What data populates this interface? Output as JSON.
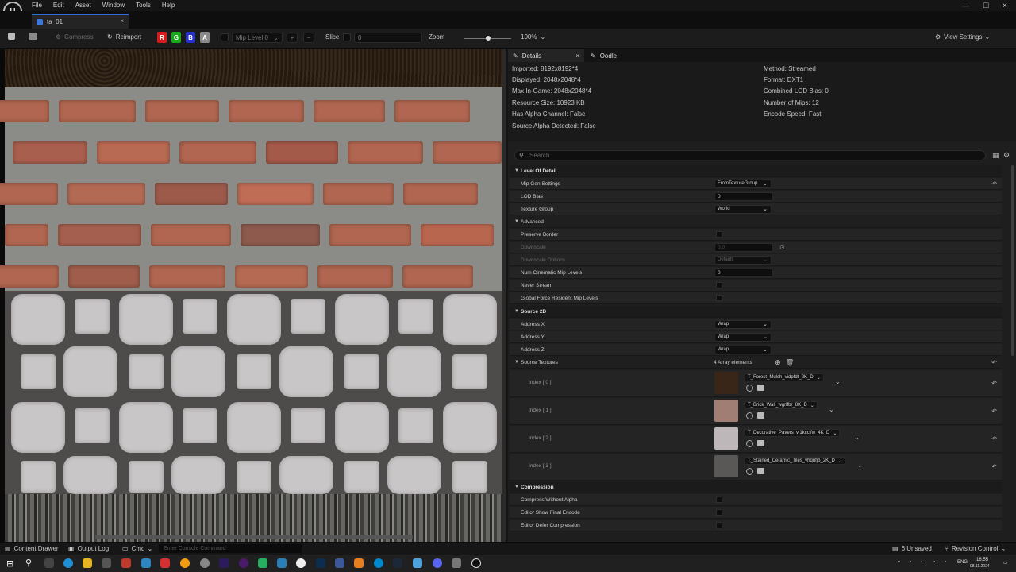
{
  "window": {
    "menus": [
      "File",
      "Edit",
      "Asset",
      "Window",
      "Tools",
      "Help"
    ],
    "logo_text": "U",
    "tab_title": "ta_01",
    "tab_close": "×",
    "controls": [
      "—",
      "☐",
      "✕"
    ]
  },
  "toolbar": {
    "compress": "Compress",
    "reimport": "Reimport",
    "channels": [
      "R",
      "G",
      "B",
      "A"
    ],
    "mip_level": "Mip Level 0",
    "slice_label": "Slice",
    "slice_value": "0",
    "zoom_label": "Zoom",
    "zoom_value": "100%",
    "view_settings": "View Settings"
  },
  "details": {
    "tab_details": "Details",
    "tab_oodle": "Oodle",
    "info_left": [
      "Imported: 8192x8192*4",
      "Displayed: 2048x2048*4",
      "Max In-Game: 2048x2048*4",
      "Resource Size: 10923 KB",
      "Has Alpha Channel: False",
      "Source Alpha Detected: False"
    ],
    "info_right": [
      "Method: Streamed",
      "Format: DXT1",
      "Combined LOD Bias: 0",
      "Number of Mips: 12",
      "Encode Speed: Fast"
    ],
    "search_placeholder": "Search",
    "lod": {
      "category": "Level Of Detail",
      "mip_gen_label": "Mip Gen Settings",
      "mip_gen_value": "FromTextureGroup",
      "lod_bias_label": "LOD Bias",
      "lod_bias_value": "0",
      "texture_group_label": "Texture Group",
      "texture_group_value": "World",
      "advanced": "Advanced",
      "preserve_border": "Preserve Border",
      "downscale": "Downscale",
      "downscale_value": "0.0",
      "downscale_options": "Downscale Options",
      "downscale_options_value": "Default",
      "num_cinematic": "Num Cinematic Mip Levels",
      "num_cinematic_value": "0",
      "never_stream": "Never Stream",
      "global_force": "Global Force Resident Mip Levels"
    },
    "source2d": {
      "category": "Source 2D",
      "address_x": "Address X",
      "address_y": "Address Y",
      "address_z": "Address Z",
      "address_value": "Wrap",
      "source_textures": "Source Textures",
      "array_count": "4 Array elements",
      "items": [
        {
          "index": "Index [ 0 ]",
          "name": "T_Forest_Mulch_vidpfdt_2K_D"
        },
        {
          "index": "Index [ 1 ]",
          "name": "T_Brick_Wall_wgrlfbr_8K_D"
        },
        {
          "index": "Index [ 2 ]",
          "name": "T_Decorative_Pavers_vl1kccjfw_4K_D"
        },
        {
          "index": "Index [ 3 ]",
          "name": "T_Stained_Ceramic_Tiles_vhqnfjb_2K_D"
        }
      ]
    },
    "compression": {
      "category": "Compression",
      "items": [
        "Compress Without Alpha",
        "Editor Show Final Encode",
        "Editor Defer Compression"
      ]
    }
  },
  "statusbar": {
    "content_drawer": "Content Drawer",
    "output_log": "Output Log",
    "cmd": "Cmd",
    "console_placeholder": "Enter Console Command",
    "unsaved": "6 Unsaved",
    "revision": "Revision Control"
  },
  "taskbar": {
    "lang": "ENG",
    "time": "16:55",
    "date": "08.11.2024"
  },
  "colors": {
    "accent": "#2f6fd1",
    "panel": "#242424",
    "bg": "#151515"
  }
}
